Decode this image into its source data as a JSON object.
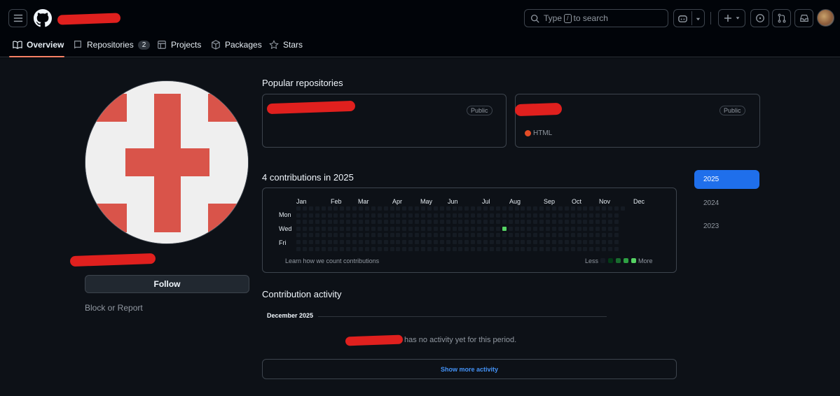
{
  "header": {
    "search_label_prefix": "Type",
    "search_slash": "/",
    "search_label_suffix": "to search"
  },
  "nav": {
    "tabs": [
      {
        "label": "Overview",
        "icon": "book-icon"
      },
      {
        "label": "Repositories",
        "icon": "repo-icon",
        "count": "2"
      },
      {
        "label": "Projects",
        "icon": "table-icon"
      },
      {
        "label": "Packages",
        "icon": "package-icon"
      },
      {
        "label": "Stars",
        "icon": "star-icon"
      }
    ]
  },
  "profile": {
    "follow_label": "Follow",
    "block_label": "Block or Report"
  },
  "popular": {
    "title": "Popular repositories",
    "repos": [
      {
        "visibility": "Public",
        "language": ""
      },
      {
        "visibility": "Public",
        "language": "HTML",
        "language_color": "#e34c26"
      }
    ]
  },
  "contributions": {
    "title": "4 contributions in 2025",
    "months": [
      "Jan",
      "Feb",
      "Mar",
      "Apr",
      "May",
      "Jun",
      "Jul",
      "Aug",
      "Sep",
      "Oct",
      "Nov",
      "Dec"
    ],
    "days": [
      "Mon",
      "Wed",
      "Fri"
    ],
    "learn_link": "Learn how we count contributions",
    "less": "Less",
    "more": "More",
    "active_week": 33,
    "active_day": 3,
    "legend_colors": [
      "#151b23",
      "#033a16",
      "#196c2e",
      "#2ea043",
      "#56d364"
    ]
  },
  "years": [
    "2025",
    "2024",
    "2023"
  ],
  "activity": {
    "title": "Contribution activity",
    "month_label": "December 2025",
    "empty_text": "has no activity yet for this period.",
    "show_more": "Show more activity"
  }
}
